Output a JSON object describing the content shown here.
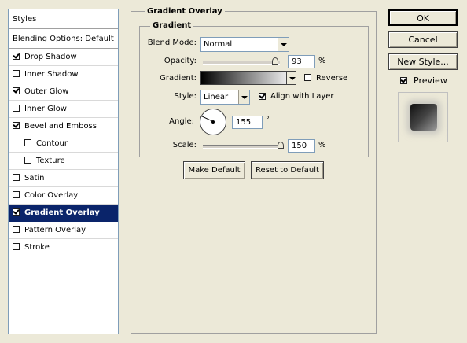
{
  "styles_panel": {
    "header": "Styles",
    "blending_options": "Blending Options: Default",
    "items": [
      {
        "label": "Drop Shadow",
        "checked": true
      },
      {
        "label": "Inner Shadow",
        "checked": false
      },
      {
        "label": "Outer Glow",
        "checked": true
      },
      {
        "label": "Inner Glow",
        "checked": false
      },
      {
        "label": "Bevel and Emboss",
        "checked": true
      },
      {
        "label": "Contour",
        "checked": false
      },
      {
        "label": "Texture",
        "checked": false
      },
      {
        "label": "Satin",
        "checked": false
      },
      {
        "label": "Color Overlay",
        "checked": false
      },
      {
        "label": "Gradient Overlay",
        "checked": true,
        "selected": true
      },
      {
        "label": "Pattern Overlay",
        "checked": false
      },
      {
        "label": "Stroke",
        "checked": false
      }
    ]
  },
  "gradient_overlay": {
    "title": "Gradient Overlay",
    "group_title": "Gradient",
    "blend_mode_label": "Blend Mode:",
    "blend_mode_value": "Normal",
    "opacity_label": "Opacity:",
    "opacity_value": "93",
    "opacity_unit": "%",
    "opacity_level": 0.93,
    "gradient_label": "Gradient:",
    "reverse_label": "Reverse",
    "reverse_checked": false,
    "style_label": "Style:",
    "style_value": "Linear",
    "align_label": "Align with Layer",
    "align_checked": true,
    "angle_label": "Angle:",
    "angle_value": "155",
    "angle_unit": "°",
    "scale_label": "Scale:",
    "scale_value": "150",
    "scale_unit": "%",
    "scale_level": 1.0,
    "make_default_label": "Make Default",
    "reset_default_label": "Reset to Default"
  },
  "actions": {
    "ok_label": "OK",
    "cancel_label": "Cancel",
    "new_style_label": "New Style...",
    "preview_label": "Preview",
    "preview_checked": true
  },
  "colors": {
    "selection": "#0a246a",
    "dialog_bg": "#ece9d8"
  }
}
